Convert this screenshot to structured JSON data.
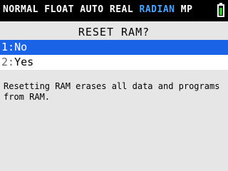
{
  "statusbar": {
    "mode_left": "NORMAL FLOAT AUTO REAL ",
    "mode_accent": "RADIAN",
    "mode_right": " MP",
    "accent_color": "#4da3ff",
    "battery_icon": "battery-icon"
  },
  "dialog": {
    "title": "RESET RAM?",
    "options": [
      {
        "number": "1:",
        "label": "No"
      },
      {
        "number": "2:",
        "label": "Yes"
      }
    ],
    "message": "Resetting RAM erases all data and programs from RAM."
  }
}
